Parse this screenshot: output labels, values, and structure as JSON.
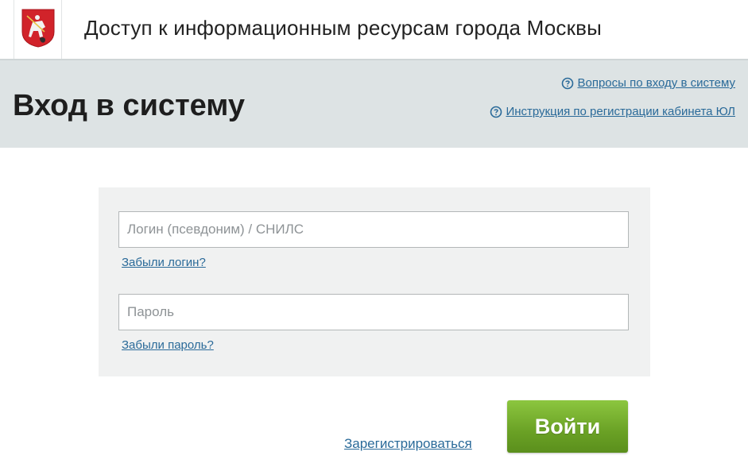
{
  "header": {
    "logo_icon": "moscow-coat-of-arms-icon",
    "title": "Доступ к информационным ресурсам города Москвы"
  },
  "hero": {
    "page_title": "Вход в систему",
    "links": [
      {
        "icon": "question-circle-icon",
        "label": "Вопросы по входу в систему"
      },
      {
        "icon": "question-circle-icon",
        "label": "Инструкция по регистрации кабинета ЮЛ"
      }
    ]
  },
  "form": {
    "login_placeholder": "Логин (псевдоним) / СНИЛС",
    "login_value": "",
    "forgot_login": "Забыли логин?",
    "password_placeholder": "Пароль",
    "password_value": "",
    "forgot_password": "Забыли пароль?",
    "register_label": "Зарегистрироваться",
    "submit_label": "Войти"
  },
  "colors": {
    "link": "#2a6a99",
    "hero_background": "#dde3e4",
    "panel_background": "#f0f1f1",
    "button_green": "#6aa125",
    "crest_red": "#d1232a"
  }
}
